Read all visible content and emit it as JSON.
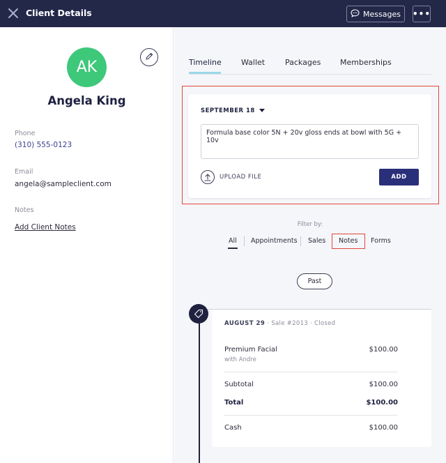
{
  "header": {
    "title": "Client Details",
    "messages_label": "Messages",
    "more_label": "•••"
  },
  "client": {
    "initials": "AK",
    "avatar_color": "#3ec87a",
    "name": "Angela King",
    "phone_label": "Phone",
    "phone": "(310) 555-0123",
    "email_label": "Email",
    "email": "angela@sampleclient.com",
    "notes_label": "Notes",
    "add_notes_link": "Add Client Notes"
  },
  "tabs": [
    {
      "label": "Timeline",
      "active": true
    },
    {
      "label": "Wallet",
      "active": false
    },
    {
      "label": "Packages",
      "active": false
    },
    {
      "label": "Memberships",
      "active": false
    }
  ],
  "composer": {
    "date": "SEPTEMBER 18",
    "note_value": "Formula base color 5N + 20v gloss ends at bowl with 5G + 10v",
    "upload_label": "UPLOAD FILE",
    "add_label": "ADD"
  },
  "filter": {
    "label": "Filter by:",
    "options": [
      "All",
      "Appointments",
      "Sales",
      "Notes",
      "Forms"
    ],
    "selected": "All"
  },
  "past_label": "Past",
  "sale": {
    "date": "AUGUST 29",
    "sale_label": "Sale #2013",
    "status": "Closed",
    "item_name": "Premium Facial",
    "item_with": "with Andre",
    "item_amount": "$100.00",
    "subtotal_label": "Subtotal",
    "subtotal": "$100.00",
    "total_label": "Total",
    "total": "$100.00",
    "payment_label": "Cash",
    "payment": "$100.00"
  },
  "colors": {
    "header_bg": "#232849",
    "accent": "#2a2f7a",
    "highlight": "#e0463e",
    "tab_underline": "#9bd8e8"
  }
}
